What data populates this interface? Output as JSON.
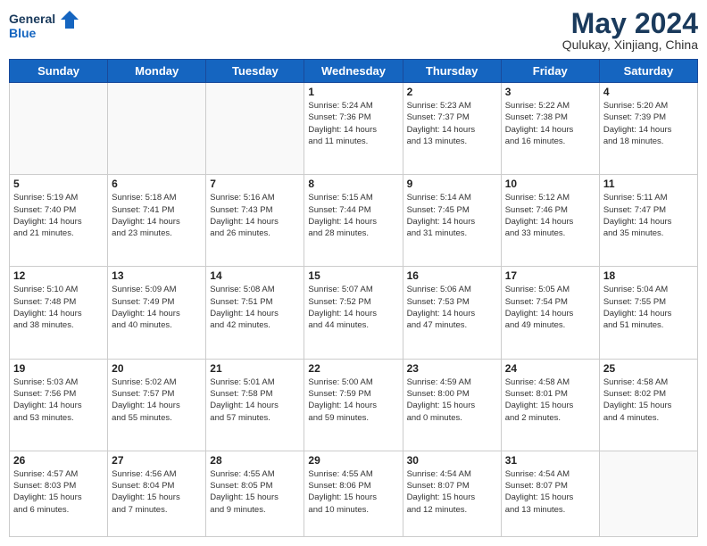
{
  "header": {
    "logo": {
      "general": "General",
      "blue": "Blue"
    },
    "month": "May 2024",
    "location": "Qulukay, Xinjiang, China"
  },
  "weekdays": [
    "Sunday",
    "Monday",
    "Tuesday",
    "Wednesday",
    "Thursday",
    "Friday",
    "Saturday"
  ],
  "weeks": [
    [
      {
        "day": null,
        "info": null
      },
      {
        "day": null,
        "info": null
      },
      {
        "day": null,
        "info": null
      },
      {
        "day": "1",
        "info": "Sunrise: 5:24 AM\nSunset: 7:36 PM\nDaylight: 14 hours\nand 11 minutes."
      },
      {
        "day": "2",
        "info": "Sunrise: 5:23 AM\nSunset: 7:37 PM\nDaylight: 14 hours\nand 13 minutes."
      },
      {
        "day": "3",
        "info": "Sunrise: 5:22 AM\nSunset: 7:38 PM\nDaylight: 14 hours\nand 16 minutes."
      },
      {
        "day": "4",
        "info": "Sunrise: 5:20 AM\nSunset: 7:39 PM\nDaylight: 14 hours\nand 18 minutes."
      }
    ],
    [
      {
        "day": "5",
        "info": "Sunrise: 5:19 AM\nSunset: 7:40 PM\nDaylight: 14 hours\nand 21 minutes."
      },
      {
        "day": "6",
        "info": "Sunrise: 5:18 AM\nSunset: 7:41 PM\nDaylight: 14 hours\nand 23 minutes."
      },
      {
        "day": "7",
        "info": "Sunrise: 5:16 AM\nSunset: 7:43 PM\nDaylight: 14 hours\nand 26 minutes."
      },
      {
        "day": "8",
        "info": "Sunrise: 5:15 AM\nSunset: 7:44 PM\nDaylight: 14 hours\nand 28 minutes."
      },
      {
        "day": "9",
        "info": "Sunrise: 5:14 AM\nSunset: 7:45 PM\nDaylight: 14 hours\nand 31 minutes."
      },
      {
        "day": "10",
        "info": "Sunrise: 5:12 AM\nSunset: 7:46 PM\nDaylight: 14 hours\nand 33 minutes."
      },
      {
        "day": "11",
        "info": "Sunrise: 5:11 AM\nSunset: 7:47 PM\nDaylight: 14 hours\nand 35 minutes."
      }
    ],
    [
      {
        "day": "12",
        "info": "Sunrise: 5:10 AM\nSunset: 7:48 PM\nDaylight: 14 hours\nand 38 minutes."
      },
      {
        "day": "13",
        "info": "Sunrise: 5:09 AM\nSunset: 7:49 PM\nDaylight: 14 hours\nand 40 minutes."
      },
      {
        "day": "14",
        "info": "Sunrise: 5:08 AM\nSunset: 7:51 PM\nDaylight: 14 hours\nand 42 minutes."
      },
      {
        "day": "15",
        "info": "Sunrise: 5:07 AM\nSunset: 7:52 PM\nDaylight: 14 hours\nand 44 minutes."
      },
      {
        "day": "16",
        "info": "Sunrise: 5:06 AM\nSunset: 7:53 PM\nDaylight: 14 hours\nand 47 minutes."
      },
      {
        "day": "17",
        "info": "Sunrise: 5:05 AM\nSunset: 7:54 PM\nDaylight: 14 hours\nand 49 minutes."
      },
      {
        "day": "18",
        "info": "Sunrise: 5:04 AM\nSunset: 7:55 PM\nDaylight: 14 hours\nand 51 minutes."
      }
    ],
    [
      {
        "day": "19",
        "info": "Sunrise: 5:03 AM\nSunset: 7:56 PM\nDaylight: 14 hours\nand 53 minutes."
      },
      {
        "day": "20",
        "info": "Sunrise: 5:02 AM\nSunset: 7:57 PM\nDaylight: 14 hours\nand 55 minutes."
      },
      {
        "day": "21",
        "info": "Sunrise: 5:01 AM\nSunset: 7:58 PM\nDaylight: 14 hours\nand 57 minutes."
      },
      {
        "day": "22",
        "info": "Sunrise: 5:00 AM\nSunset: 7:59 PM\nDaylight: 14 hours\nand 59 minutes."
      },
      {
        "day": "23",
        "info": "Sunrise: 4:59 AM\nSunset: 8:00 PM\nDaylight: 15 hours\nand 0 minutes."
      },
      {
        "day": "24",
        "info": "Sunrise: 4:58 AM\nSunset: 8:01 PM\nDaylight: 15 hours\nand 2 minutes."
      },
      {
        "day": "25",
        "info": "Sunrise: 4:58 AM\nSunset: 8:02 PM\nDaylight: 15 hours\nand 4 minutes."
      }
    ],
    [
      {
        "day": "26",
        "info": "Sunrise: 4:57 AM\nSunset: 8:03 PM\nDaylight: 15 hours\nand 6 minutes."
      },
      {
        "day": "27",
        "info": "Sunrise: 4:56 AM\nSunset: 8:04 PM\nDaylight: 15 hours\nand 7 minutes."
      },
      {
        "day": "28",
        "info": "Sunrise: 4:55 AM\nSunset: 8:05 PM\nDaylight: 15 hours\nand 9 minutes."
      },
      {
        "day": "29",
        "info": "Sunrise: 4:55 AM\nSunset: 8:06 PM\nDaylight: 15 hours\nand 10 minutes."
      },
      {
        "day": "30",
        "info": "Sunrise: 4:54 AM\nSunset: 8:07 PM\nDaylight: 15 hours\nand 12 minutes."
      },
      {
        "day": "31",
        "info": "Sunrise: 4:54 AM\nSunset: 8:07 PM\nDaylight: 15 hours\nand 13 minutes."
      },
      {
        "day": null,
        "info": null
      }
    ]
  ]
}
